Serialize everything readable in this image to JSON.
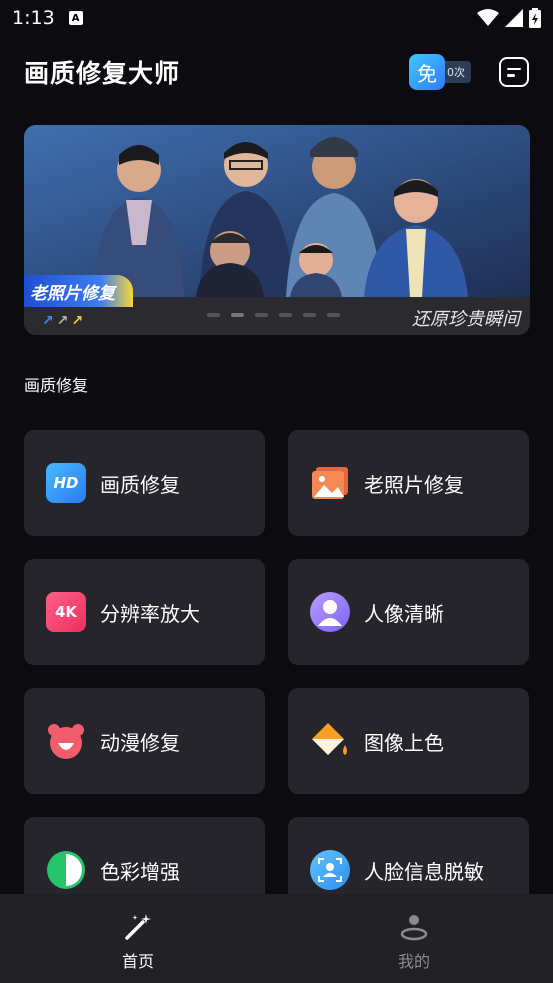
{
  "status": {
    "time": "1:13",
    "indicator": "A"
  },
  "header": {
    "title": "画质修复大师",
    "free_label": "免",
    "free_count": "0次"
  },
  "banner": {
    "tag": "老照片修复",
    "slogan": "还原珍贵瞬间",
    "arrows": [
      "↗",
      "↗",
      "↗"
    ],
    "slide_count": 6,
    "active_slide": 2
  },
  "section": {
    "title": "画质修复"
  },
  "features": [
    {
      "label": "画质修复",
      "icon": "hd-icon"
    },
    {
      "label": "老照片修复",
      "icon": "old-photo-icon"
    },
    {
      "label": "分辨率放大",
      "icon": "4k-icon"
    },
    {
      "label": "人像清晰",
      "icon": "portrait-icon"
    },
    {
      "label": "动漫修复",
      "icon": "anime-bear-icon"
    },
    {
      "label": "图像上色",
      "icon": "paint-bucket-icon"
    },
    {
      "label": "色彩增强",
      "icon": "color-enhance-icon"
    },
    {
      "label": "人脸信息脱敏",
      "icon": "face-scan-icon"
    }
  ],
  "icon_text": {
    "hd": "HD",
    "fourk": "4K"
  },
  "tabbar": {
    "home": "首页",
    "mine": "我的"
  },
  "colors": {
    "background": "#0b0b10",
    "card": "#25252b",
    "tabbar": "#222226",
    "accent": "#2f7bff"
  }
}
